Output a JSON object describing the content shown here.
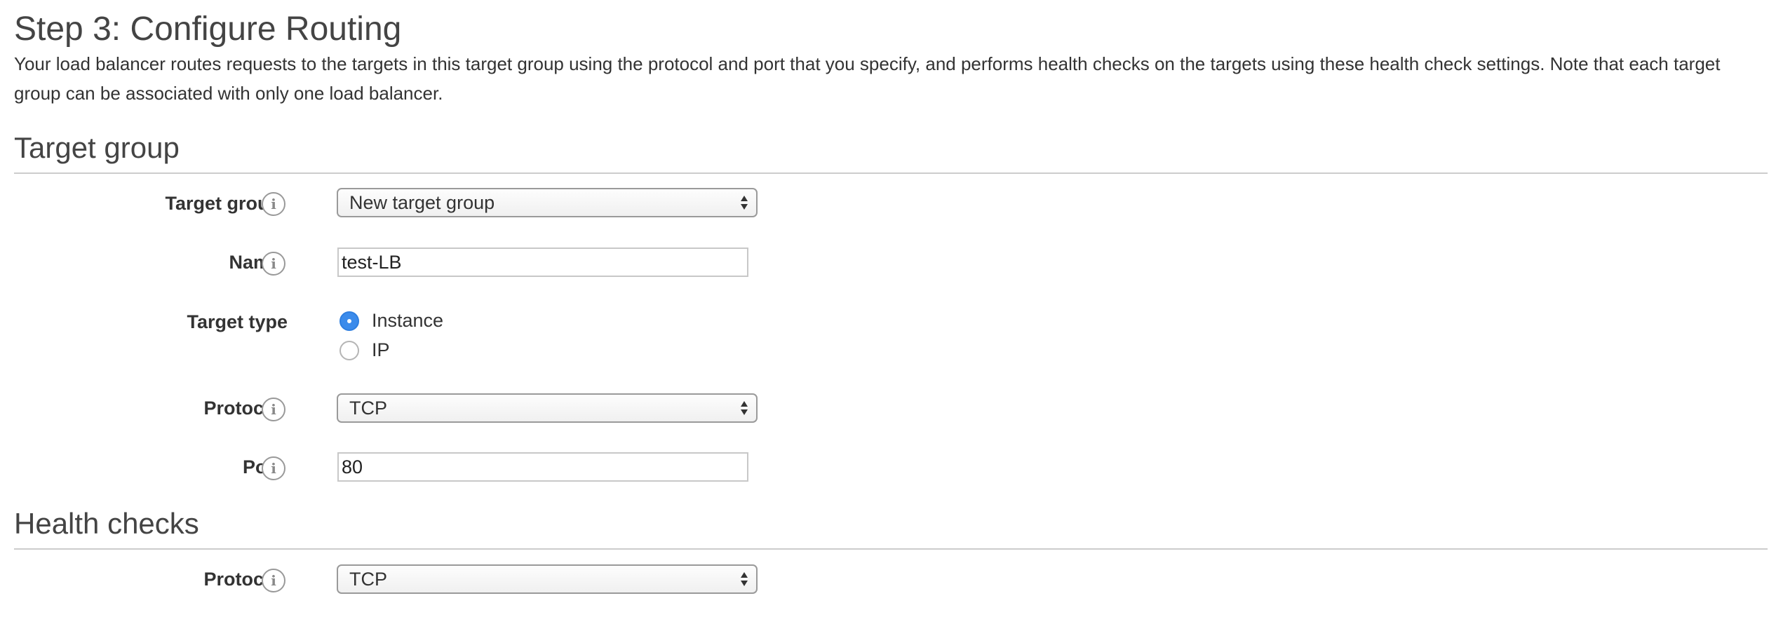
{
  "page": {
    "title": "Step 3: Configure Routing",
    "description": "Your load balancer routes requests to the targets in this target group using the protocol and port that you specify, and performs health checks on the targets using these health check settings. Note that each target group can be associated with only one load balancer."
  },
  "target_group_section": {
    "title": "Target group",
    "target_group": {
      "label": "Target group",
      "value": "New target group"
    },
    "name": {
      "label": "Name",
      "value": "test-LB"
    },
    "target_type": {
      "label": "Target type",
      "options": [
        {
          "label": "Instance",
          "selected": true
        },
        {
          "label": "IP",
          "selected": false
        }
      ]
    },
    "protocol": {
      "label": "Protocol",
      "value": "TCP"
    },
    "port": {
      "label": "Port",
      "value": "80"
    }
  },
  "health_checks_section": {
    "title": "Health checks",
    "protocol": {
      "label": "Protocol",
      "value": "TCP"
    }
  },
  "icons": {
    "info": "info-icon",
    "select_arrows": "select-arrows-icon"
  },
  "colors": {
    "radio_selected": "#3b8beb",
    "divider": "#cccccc",
    "text": "#333333"
  }
}
